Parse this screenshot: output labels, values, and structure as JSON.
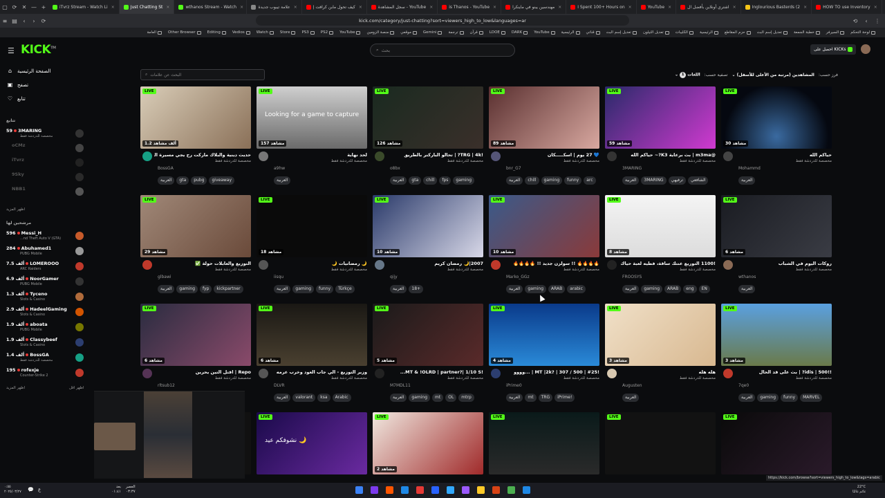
{
  "browser": {
    "tabs": [
      {
        "label": "iTvrz Stream - Watch Li",
        "color": "#53fc18"
      },
      {
        "label": "Just Chatting St",
        "color": "#53fc18",
        "active": true
      },
      {
        "label": "wthanos Stream - Watch",
        "color": "#53fc18"
      },
      {
        "label": "علامة تيبوب جديدة",
        "color": "#888888"
      },
      {
        "label": "كيف تحول مابن كرافت إ",
        "color": "#ff0000"
      },
      {
        "label": "سجل المشاهدة - YouTube",
        "color": "#ff0000"
      },
      {
        "label": "is Thanos - YouTube",
        "color": "#ff0000"
      },
      {
        "label": "مهندسين يبنو في ماينكرا",
        "color": "#ff0000"
      },
      {
        "label": "I Spent 100+ Hours on",
        "color": "#ff0000"
      },
      {
        "label": "YouTube",
        "color": "#ff0000"
      },
      {
        "label": "اشتري أونلاين بأفضل ال",
        "color": "#ff0000"
      },
      {
        "label": "Inglourious Basterds (2",
        "color": "#f5c518"
      },
      {
        "label": "HOW TO use Inventory",
        "color": "#ff0000"
      }
    ],
    "url": "kick.com/category/just-chatting?sort=viewers_high_to_low&languages=ar",
    "bookmarks": [
      "لوحة التحكم",
      "السيرفر",
      "خطبة الجمعة",
      "تعديل إسم البث",
      "حزم المقاطع",
      "الرئيسية",
      "الكليبات",
      "تعديل الثيلون",
      "تعديل إسم البث",
      "قناتي",
      "الرئيسية",
      "YouTube",
      "DARK",
      "LDOE",
      "قرآن",
      "ترجمة",
      "Gemini",
      "موقعي",
      "منصة الزومين",
      "YouTube",
      "PS2",
      "PS3",
      "Store",
      "Watch",
      "Vedios",
      "Editing",
      "Other Browser",
      "العامة"
    ],
    "status_url": "https://kick.com/browse?sort=viewers_high_to_low&tags=arabic"
  },
  "header": {
    "logo": "KICK",
    "search_placeholder": "بحث",
    "get_kicks": "احصل على KICKs"
  },
  "sidebar": {
    "nav": [
      {
        "label": "الصفحة الرئيسية",
        "icon": "⌂"
      },
      {
        "label": "تصفح",
        "icon": "▣"
      },
      {
        "label": "تتابع",
        "icon": "♡"
      }
    ],
    "following_header": "تتابع",
    "following": [
      {
        "count": "59",
        "name": "3MARING",
        "sub": "مخصصة للدردشة فقط",
        "dim": false,
        "avatar": "#333333"
      },
      {
        "count": "",
        "name": "oCMz",
        "sub": "",
        "dim": true,
        "avatar": "#444444"
      },
      {
        "count": "",
        "name": "iTvrz",
        "sub": "",
        "dim": true,
        "avatar": "#222222"
      },
      {
        "count": "",
        "name": "9Sky",
        "sub": "",
        "dim": true,
        "avatar": "#2a2a2a"
      },
      {
        "count": "",
        "name": "NBB1",
        "sub": "",
        "dim": true,
        "avatar": "#555555"
      }
    ],
    "show_more": "اظهر المزيد",
    "recommended_header": "مرشحين لها",
    "recommended": [
      {
        "count": "596",
        "name": "Messi_H",
        "sub": "...nd Theft Auto V (GTA)",
        "avatar": "#c75a2a"
      },
      {
        "count": "284",
        "name": "Abuhamed1",
        "sub": "PUBG Mobile",
        "avatar": "#999999"
      },
      {
        "count": "7.5 ألف",
        "name": "LOMEROOO",
        "sub": "ARC Raiders",
        "avatar": "#c0392b"
      },
      {
        "count": "6.9 ألف",
        "name": "NoorGamer",
        "sub": "PUBG Mobile",
        "avatar": "#333333"
      },
      {
        "count": "1.3 ألف",
        "name": "Tyceno",
        "sub": "Slots & Casino",
        "avatar": "#b06b3b"
      },
      {
        "count": "2.9 ألف",
        "name": "HadeelGaming",
        "sub": "Slots & Casino",
        "avatar": "#d35400"
      },
      {
        "count": "1.9 ألف",
        "name": "aboata",
        "sub": "PUBG Mobile",
        "avatar": "#777700"
      },
      {
        "count": "1.9 ألف",
        "name": "Classybeef",
        "sub": "Slots & Casino",
        "avatar": "#2c3e70"
      },
      {
        "count": "1.4 ألف",
        "name": "BossGA",
        "sub": "مخصصة للدردشة فقط",
        "avatar": "#16a085"
      },
      {
        "count": "195",
        "name": "rofexje",
        "sub": "Counter-Strike 2",
        "avatar": "#c0392b"
      }
    ],
    "show_more2": "اظهر المزيد",
    "show_less": "اظهر اقل"
  },
  "filters": {
    "search_placeholder": "البحث عن علامات",
    "sort_label": "فرز حسب:",
    "sort_value": "المشاهدين (مرتبة من الأعلى للأسفل)",
    "filter_label": "تصفية حسب:",
    "languages_label": "اللغات",
    "languages_count": "1"
  },
  "live_label": "LIVE",
  "cards": [
    {
      "viewers": "1.2 ألف مشاهد",
      "title": "حديث دينية والبلاك ماركت رح يجي مسيرة الداخلية",
      "cat": "مخصصة للدردشة فقط",
      "name": "BossGA",
      "tags": [
        "العربية",
        "gta",
        "pubg",
        "giveaway"
      ],
      "bg": "linear-gradient(135deg,#d9cdb8,#8a7058)",
      "av": "#16a085"
    },
    {
      "viewers": "157 مشاهد",
      "title": "لحد نهاية",
      "cat": "مخصصة للدردشة فقط",
      "name": "a9hw",
      "tags": [
        "العربية"
      ],
      "bg": "linear-gradient(180deg,#cfcfcf,#6a6a6a)",
      "av": "#777777",
      "overlay": "Looking for a game to capture"
    },
    {
      "viewers": "126 مشاهد",
      "title": "!TRG | 4k? | تحالو الباركنر بالطريق",
      "cat": "مخصصة للدردشة فقط",
      "name": "o8bx",
      "tags": [
        "العربية",
        "gta",
        "chill",
        "fps",
        "gaming"
      ],
      "bg": "linear-gradient(135deg,#1a2a20,#3a2f2a)",
      "av": "#3a4a2a"
    },
    {
      "viewers": "89 مشاهد",
      "title": "💙 27 يوم | اسكـــــكان",
      "cat": "مخصصة للدردشة فقط",
      "name": "bnr_G7",
      "tags": [
        "العربية",
        "chill",
        "gaming",
        "funny",
        "arc"
      ],
      "bg": "linear-gradient(135deg,#5a3030,#d8a8a0)",
      "av": "#555577"
    },
    {
      "viewers": "59 مشاهد",
      "title": "@m3ma | بث برعاية K3?~ حياكم الله",
      "cat": "مخصصة للدردشة فقط",
      "name": "3MARING",
      "tags": [
        "العربية",
        "3MARING",
        "ترفيهي",
        "الشافعي"
      ],
      "bg": "linear-gradient(135deg,#2a2a6a,#d03ad0)",
      "av": "#333333"
    },
    {
      "viewers": "30 مشاهد",
      "title": "حياكم الله",
      "cat": "مخصصة للدردشة فقط",
      "name": "Mohammd",
      "tags": [
        "العربية"
      ],
      "bg": "radial-gradient(circle at 50% 80%,#3a6aa0,#050810 70%)",
      "av": "#444444"
    },
    {
      "viewers": "29 مشاهد",
      "title": "التوزيع والعابلات حولة ✅",
      "cat": "مخصصة للدردشة فقط",
      "name": "glbawi",
      "tags": [
        "العربية",
        "gaming",
        "fyp",
        "kickpartner"
      ],
      "bg": "linear-gradient(135deg,#a08878,#6a4a3a)",
      "av": "#c0392b"
    },
    {
      "viewers": "18 مشاهد",
      "title": "🌙 رمضانيات 🌙",
      "cat": "مخصصة للدردشة فقط",
      "name": "iisqu",
      "tags": [
        "العربية",
        "gaming",
        "funny",
        "Türkçe"
      ],
      "bg": "#0a0a0a",
      "av": "#555555"
    },
    {
      "viewers": "10 مشاهد",
      "title": "2007|🌙 رمضان كريم",
      "cat": "مخصصة للدردشة فقط",
      "name": "qijy",
      "tags": [
        "العربية",
        "18+"
      ],
      "bg": "linear-gradient(135deg,#2a3a6a,#d8d8e8)",
      "av": "#667788"
    },
    {
      "viewers": "10 مشاهد",
      "title": "🔥🔥🔥🔥 !! سولزن جديد !! 🔥🔥🔥🔥",
      "cat": "مخصصة للدردشة فقط",
      "name": "Marko_GGz",
      "tags": [
        "العربية",
        "gaming",
        "ARAB",
        "arabic"
      ],
      "bg": "linear-gradient(135deg,#3a5a8a,#8a3a3a)",
      "av": "#c0392b"
    },
    {
      "viewers": "8 مشاهد",
      "title": "!1100 التوريع عنتك ساقة، فطيه لعبة حياك",
      "cat": "مخصصة للدردشة فقط",
      "name": "FROOSYS",
      "tags": [
        "العربية",
        "gaming",
        "ARAB",
        "eng",
        "EN"
      ],
      "bg": "linear-gradient(180deg,#f4f4f4,#dcdcdc)",
      "av": "#222222"
    },
    {
      "viewers": "6 مشاهد",
      "title": "روكات اليوم في الشباب",
      "cat": "مخصصة للدردشة فقط",
      "name": "wthanos",
      "tags": [
        "العربية"
      ],
      "bg": "linear-gradient(135deg,#1a1c22,#3a3c44)",
      "av": "#8a6a55"
    },
    {
      "viewers": "6 مشاهد",
      "title": "Repo | اقتل التين يحرين",
      "cat": "مخصصة للدردشة فقط",
      "name": "rltsub12",
      "tags": [
        "العربية"
      ],
      "bg": "linear-gradient(135deg,#2a2c40,#8a4a6a)",
      "av": "#553355"
    },
    {
      "viewers": "6 مشاهد",
      "title": "وزير التوزيع - الي جاب العود وخرب عرمه",
      "cat": "مخصصة للدردشة فقط",
      "name": "DLVR",
      "tags": [
        "العربية",
        "valorant",
        "ksa",
        "Arabic"
      ],
      "bg": "linear-gradient(180deg,#1a1814,#4a4030)",
      "av": "#555555"
    },
    {
      "viewers": "5 مشاهد",
      "title": "!MT & !OLRD | partner?| 1/10 S...",
      "cat": "مخصصة للدردشة فقط",
      "name": "M7MDL11",
      "tags": [
        "العربية",
        "gaming",
        "mt",
        "OL",
        "mtrp"
      ],
      "bg": "linear-gradient(135deg,#1a1a1a,#5a2a2a)",
      "av": "#222222"
    },
    {
      "viewers": "4 مشاهد",
      "title": "!MT |2k? | 307 / 500 | #25 | ...وووو",
      "cat": "مخصصة للدردشة فقط",
      "name": "iPrime0",
      "tags": [
        "العربية",
        "mt",
        "TRG",
        "iPrime!"
      ],
      "bg": "linear-gradient(180deg,#0a3a8a,#2a8ad8)",
      "av": "#2c3e70"
    },
    {
      "viewers": "3 مشاهد",
      "title": "هله هله",
      "cat": "مخصصة للدردشة فقط",
      "name": "Augusten",
      "tags": [
        "العربية"
      ],
      "bg": "linear-gradient(135deg,#f0e0c8,#d8b890)",
      "av": "#d8c8b0"
    },
    {
      "viewers": "3 مشاهد",
      "title": "!!idis | 500? | بث على قد الحال",
      "cat": "مخصصة للدردشة فقط",
      "name": "7qe0",
      "tags": [
        "العربية",
        "gaming",
        "funny",
        "MARVEL"
      ],
      "bg": "linear-gradient(180deg,#5aa0e0,#6a7a4a)",
      "av": "#c0392b"
    },
    {
      "viewers": "",
      "title": "",
      "cat": "",
      "name": "",
      "tags": [],
      "bg": "#111111",
      "av": ""
    },
    {
      "viewers": "",
      "title": "",
      "cat": "",
      "name": "",
      "tags": [],
      "bg": "linear-gradient(135deg,#1a0a4a,#6a2aa0)",
      "av": "",
      "overlay": "نشوفكم عيد 🌙"
    },
    {
      "viewers": "2 مشاهد",
      "title": "",
      "cat": "",
      "name": "",
      "tags": [],
      "bg": "linear-gradient(135deg,#f0e8e0,#a02a2a)",
      "av": ""
    },
    {
      "viewers": "",
      "title": "",
      "cat": "",
      "name": "",
      "tags": [],
      "bg": "linear-gradient(180deg,#0a1a1a,#2a2a2a)",
      "av": ""
    },
    {
      "viewers": "",
      "title": "",
      "cat": "",
      "name": "",
      "tags": [],
      "bg": "#121212",
      "av": ""
    },
    {
      "viewers": "",
      "title": "",
      "cat": "",
      "name": "",
      "tags": [],
      "bg": "linear-gradient(135deg,#0a0a0a,#2a1a2a)",
      "av": ""
    }
  ],
  "taskbar": {
    "time": "٠:٥٥",
    "date": "٢٠٢٥/٠٣/٢٧",
    "prayer_label": "بعد",
    "prayer_time": "٠١:٤١",
    "prayer_name": "العصر",
    "prayer_clock": "٠٣:٣٧",
    "weather_temp": "22°C",
    "weather_desc": "غائم غالبًا",
    "icons": [
      "#3b82f6",
      "#7c3aed",
      "#ff5500",
      "#1e88e5",
      "#e53935",
      "#2962ff",
      "#31a8ff",
      "#9b59ff",
      "#ffca28",
      "#d84315",
      "#4caf50",
      "#1e88e5"
    ]
  }
}
